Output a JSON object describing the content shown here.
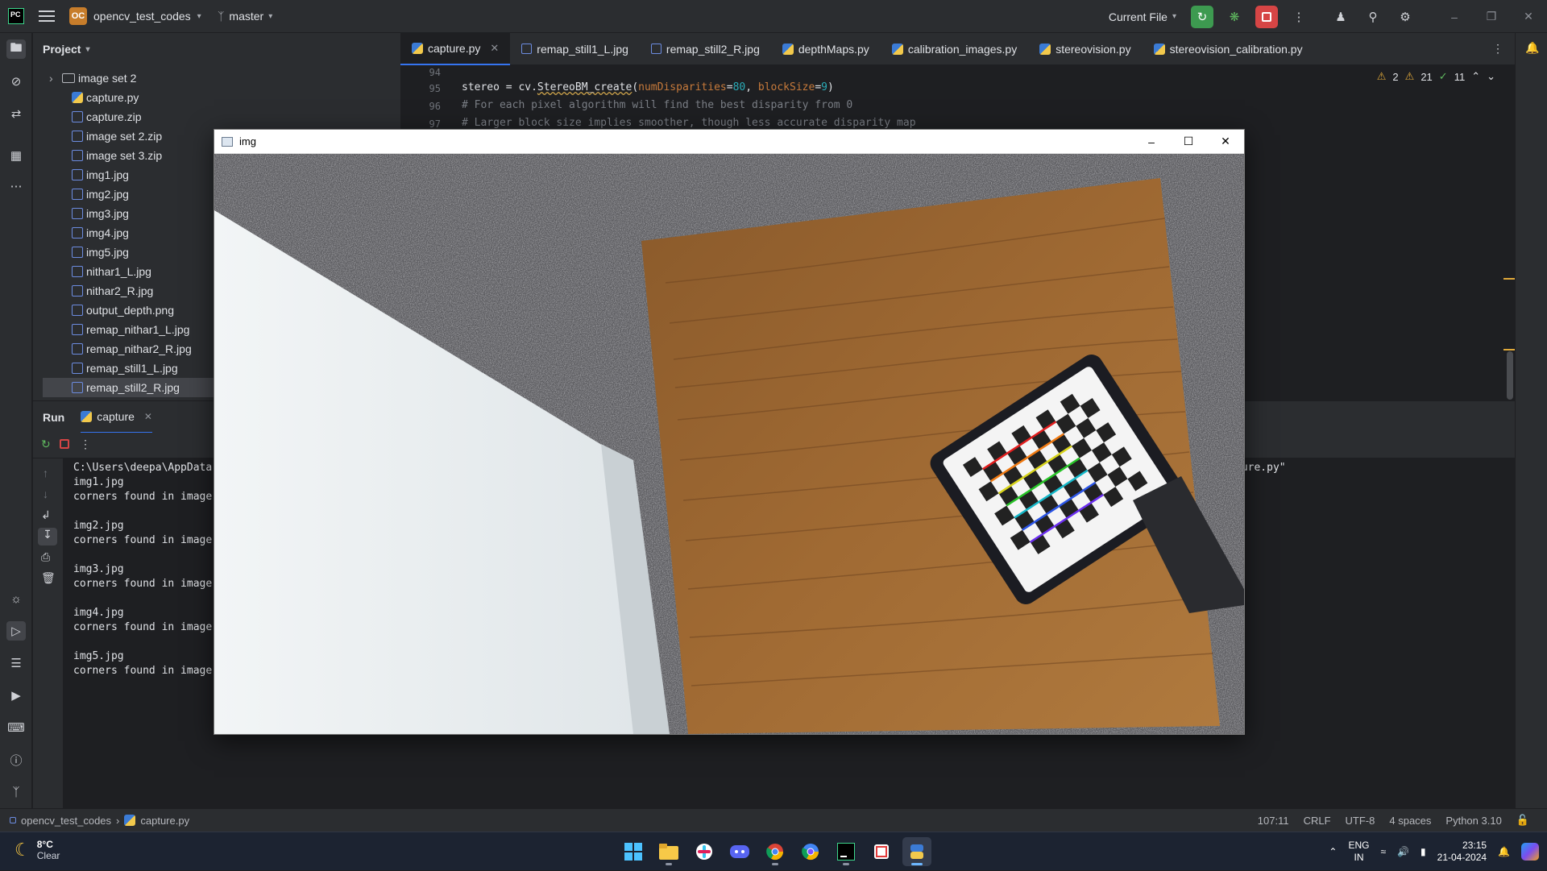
{
  "titlebar": {
    "logo": "PC",
    "project_badge": "OC",
    "project_name": "opencv_test_codes",
    "branch": "master",
    "run_config": "Current File"
  },
  "project_panel": {
    "title": "Project",
    "items": [
      {
        "label": "image set 2",
        "kind": "folder"
      },
      {
        "label": "capture.py",
        "kind": "py"
      },
      {
        "label": "capture.zip",
        "kind": "zip"
      },
      {
        "label": "image set 2.zip",
        "kind": "zip"
      },
      {
        "label": "image set 3.zip",
        "kind": "zip"
      },
      {
        "label": "img1.jpg",
        "kind": "img"
      },
      {
        "label": "img2.jpg",
        "kind": "img"
      },
      {
        "label": "img3.jpg",
        "kind": "img"
      },
      {
        "label": "img4.jpg",
        "kind": "img"
      },
      {
        "label": "img5.jpg",
        "kind": "img"
      },
      {
        "label": "nithar1_L.jpg",
        "kind": "img"
      },
      {
        "label": "nithar2_R.jpg",
        "kind": "img"
      },
      {
        "label": "output_depth.png",
        "kind": "img"
      },
      {
        "label": "remap_nithar1_L.jpg",
        "kind": "img"
      },
      {
        "label": "remap_nithar2_R.jpg",
        "kind": "img"
      },
      {
        "label": "remap_still1_L.jpg",
        "kind": "img"
      },
      {
        "label": "remap_still2_R.jpg",
        "kind": "img",
        "selected": true
      }
    ]
  },
  "tabs": [
    {
      "label": "capture.py",
      "icon": "python-file-icon",
      "active": true
    },
    {
      "label": "remap_still1_L.jpg",
      "icon": "image-file-icon"
    },
    {
      "label": "remap_still2_R.jpg",
      "icon": "image-file-icon"
    },
    {
      "label": "depthMaps.py",
      "icon": "python-file-icon"
    },
    {
      "label": "calibration_images.py",
      "icon": "python-file-icon"
    },
    {
      "label": "stereovision.py",
      "icon": "python-file-icon"
    },
    {
      "label": "stereovision_calibration.py",
      "icon": "python-file-icon"
    }
  ],
  "editor": {
    "line_numbers": [
      "94",
      "95",
      "96",
      "97"
    ],
    "line95": {
      "prefix": "stereo = cv.",
      "fn": "StereoBM_create",
      "open": "(",
      "p1": "numDisparities",
      "eq1": "=",
      "v1": "80",
      "sep": ", ",
      "p2": "blockSize",
      "eq2": "=",
      "v2": "9",
      "close": ")"
    },
    "line96": "# For each pixel algorithm will find the best disparity from 0",
    "line97": "# Larger block size implies smoother, though less accurate disparity map",
    "inspections": {
      "warnings_a": "2",
      "warnings_b": "21",
      "ok": "11"
    }
  },
  "run_panel": {
    "label": "Run",
    "tab": "capture",
    "console": [
      "C:\\Users\\deepa\\AppData",
      "img1.jpg",
      "corners found in image",
      "",
      "img2.jpg",
      "corners found in image",
      "",
      "img3.jpg",
      "corners found in image",
      "",
      "img4.jpg",
      "corners found in image",
      "",
      "img5.jpg",
      "corners found in image"
    ],
    "console_tail": "ture.py\""
  },
  "image_window": {
    "title": "img"
  },
  "statusbar": {
    "project": "opencv_test_codes",
    "file": "capture.py",
    "position": "107:11",
    "line_sep": "CRLF",
    "encoding": "UTF-8",
    "indent": "4 spaces",
    "interpreter": "Python 3.10"
  },
  "taskbar": {
    "temp": "8°C",
    "weather": "Clear",
    "lang1": "ENG",
    "lang2": "IN",
    "time": "23:15",
    "date": "21-04-2024"
  }
}
